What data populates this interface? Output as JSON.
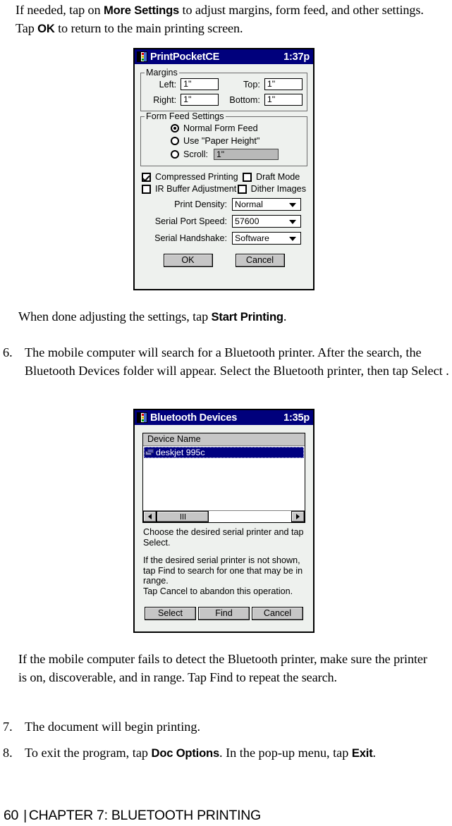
{
  "document": {
    "paragraphs": [
      {
        "id": "p-intro",
        "segments": [
          {
            "t": "If needed, tap on ",
            "b": false
          },
          {
            "t": "More Settings",
            "b": true
          },
          {
            "t": " to adjust margins, form feed, and other settings. Tap ",
            "b": false
          },
          {
            "t": "OK",
            "b": true
          },
          {
            "t": " to return to the main printing screen.",
            "b": false
          }
        ]
      },
      {
        "id": "p-start-printing",
        "segments": [
          {
            "t": "When done adjusting the settings, tap ",
            "b": false
          },
          {
            "t": "Start Printing",
            "b": true
          },
          {
            "t": ".",
            "b": false
          }
        ]
      },
      {
        "id": "p-fail-detect",
        "segments": [
          {
            "t": "If the mobile computer fails to detect the Bluetooth printer, make sure the printer is on, discoverable, and in range. Tap Find to repeat the search.",
            "b": false
          }
        ]
      }
    ],
    "numbered_items": [
      {
        "id": "step-6",
        "number": "6.",
        "segments": [
          {
            "t": "The mobile computer will search for a Bluetooth printer. After the search, the Bluetooth Devices folder will appear. Select the Bluetooth printer, then tap Select .",
            "b": false
          }
        ]
      },
      {
        "id": "step-7",
        "number": "7.",
        "segments": [
          {
            "t": "The document will begin printing.",
            "b": false
          }
        ]
      },
      {
        "id": "step-8",
        "number": "8.",
        "segments": [
          {
            "t": "To exit the program, tap ",
            "b": false
          },
          {
            "t": "Doc Options",
            "b": true
          },
          {
            "t": ". In the pop-up menu, tap ",
            "b": false
          },
          {
            "t": "Exit",
            "b": true
          },
          {
            "t": ".",
            "b": false
          }
        ]
      }
    ],
    "footer": {
      "page_number": "60",
      "separator": "|",
      "chapter": "CHAPTER 7: BLUETOOTH PRINTING"
    }
  },
  "print_settings_dialog": {
    "title": "PrintPocketCE",
    "time": "1:37p",
    "app_icon": "printpocketce-app-icon",
    "margins": {
      "group_label": "Margins",
      "left_label": "Left:",
      "left_value": "1\"",
      "top_label": "Top:",
      "top_value": "1\"",
      "right_label": "Right:",
      "right_value": "1\"",
      "bottom_label": "Bottom:",
      "bottom_value": "1\""
    },
    "form_feed": {
      "group_label": "Form Feed Settings",
      "options": [
        {
          "label": "Normal Form Feed",
          "selected": true
        },
        {
          "label": "Use \"Paper Height\"",
          "selected": false
        },
        {
          "label": "Scroll:",
          "selected": false
        }
      ],
      "scroll_value": "1\""
    },
    "checkboxes": [
      {
        "label": "Compressed Printing",
        "checked": true
      },
      {
        "label": "Draft Mode",
        "checked": false
      },
      {
        "label": "IR Buffer Adjustment",
        "checked": false
      },
      {
        "label": "Dither Images",
        "checked": false
      }
    ],
    "dropdowns": [
      {
        "label": "Print Density:",
        "value": "Normal"
      },
      {
        "label": "Serial Port Speed:",
        "value": "57600"
      },
      {
        "label": "Serial Handshake:",
        "value": "Software"
      }
    ],
    "buttons": [
      {
        "label": "OK"
      },
      {
        "label": "Cancel"
      }
    ]
  },
  "bluetooth_devices_dialog": {
    "title": "Bluetooth Devices",
    "time": "1:35p",
    "app_icon": "bluetooth-devices-app-icon",
    "list": {
      "column_header": "Device Name",
      "rows": [
        {
          "name": "deskjet 995c",
          "selected": true,
          "icon": "printer-device-icon"
        }
      ]
    },
    "scrollbar": {
      "left_arrow": "scroll-left-arrow-icon",
      "right_arrow": "scroll-right-arrow-icon"
    },
    "help_text_1": "Choose the desired serial printer and tap\nSelect.",
    "help_text_2": "If the desired serial printer is not shown,\ntap Find to search for one that may be in\nrange.\nTap Cancel to abandon this operation.",
    "buttons": [
      {
        "label": "Select"
      },
      {
        "label": "Find"
      },
      {
        "label": "Cancel"
      }
    ]
  },
  "colors": {
    "titlebar": "#00007c",
    "selection": "#000080",
    "dialog_bg": "#eef1ee",
    "button_face": "#c6c6c6"
  }
}
